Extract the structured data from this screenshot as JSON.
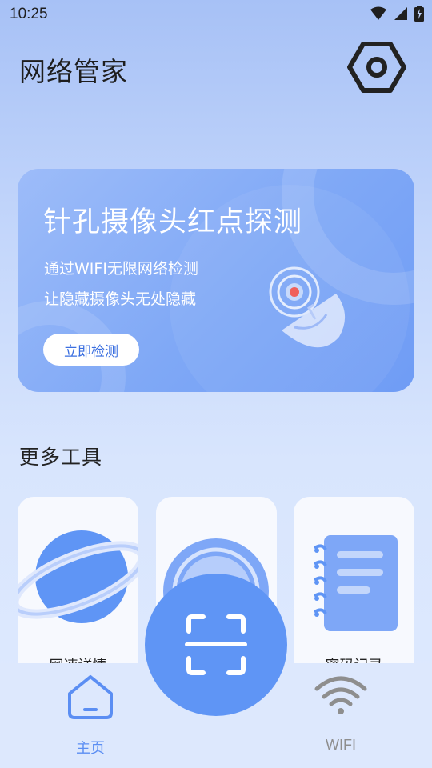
{
  "status_bar": {
    "time": "10:25",
    "icons": [
      "wifi-icon",
      "cellular-signal-icon",
      "battery-charging-icon"
    ]
  },
  "header": {
    "title": "网络管家",
    "settings_icon": "settings-hex-nut-icon"
  },
  "banner": {
    "title": "针孔摄像头红点探测",
    "line1": "通过WIFI无限网络检测",
    "line2": "让隐藏摄像头无处隐藏",
    "button_label": "立即检测",
    "illustration": "radar-dish-icon"
  },
  "tools": {
    "section_title": "更多工具",
    "items": [
      {
        "label": "网速详情",
        "icon": "planet-icon"
      },
      {
        "label": "",
        "icon": "speed-circle-icon"
      },
      {
        "label": "密码记录",
        "icon": "notebook-icon"
      }
    ]
  },
  "bottom_nav": {
    "items": [
      {
        "label": "主页",
        "icon": "home-icon",
        "active": true
      },
      {
        "label": "WIFI",
        "icon": "wifi-icon",
        "active": false
      }
    ],
    "scan_icon": "scan-frame-icon"
  },
  "colors": {
    "accent": "#5f95f5",
    "active_nav": "#5b8ef3",
    "inactive_nav": "#8e8e8e",
    "banner": "#7fa8f6"
  }
}
